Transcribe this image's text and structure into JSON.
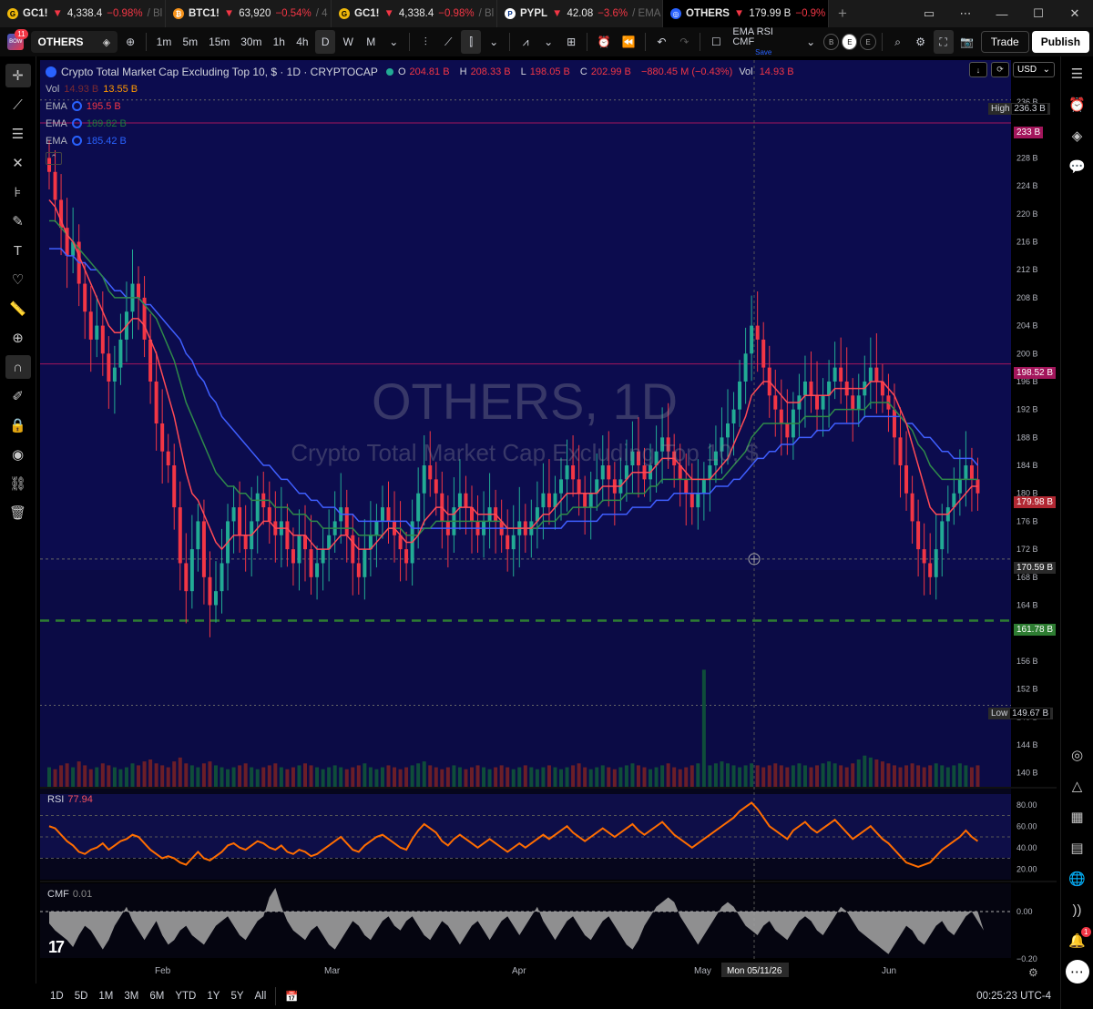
{
  "tabs": [
    {
      "symbol": "GC1!",
      "arrow": "▼",
      "price": "4,338.4",
      "change": "−0.98%",
      "more": "/ Bl",
      "icon_color": "#f0b90b",
      "icon_glyph": "G"
    },
    {
      "symbol": "BTC1!",
      "arrow": "▼",
      "price": "63,920",
      "change": "−0.54%",
      "more": "/ 4",
      "icon_color": "#f7931a",
      "icon_glyph": "₿"
    },
    {
      "symbol": "GC1!",
      "arrow": "▼",
      "price": "4,338.4",
      "change": "−0.98%",
      "more": "/ Bl",
      "icon_color": "#f0b90b",
      "icon_glyph": "G"
    },
    {
      "symbol": "PYPL",
      "arrow": "▼",
      "price": "42.08",
      "change": "−3.6%",
      "more": "/ EMA",
      "icon_color": "#ffffff",
      "icon_glyph": "P"
    },
    {
      "symbol": "OTHERS",
      "arrow": "▼",
      "price": "179.99 B",
      "change": "−0.9%",
      "more": "/",
      "icon_color": "#2962ff",
      "icon_glyph": "◎"
    }
  ],
  "toolbar": {
    "avatar_badge": "11",
    "avatar_text": "BOW",
    "symbol": "OTHERS",
    "intervals": [
      "1m",
      "5m",
      "15m",
      "30m",
      "1h",
      "4h",
      "D",
      "W",
      "M"
    ],
    "active_interval": "D",
    "layout_name": "EMA RSI CMF",
    "layout_status": "Save",
    "toggles": [
      "B",
      "E",
      "E"
    ],
    "trade_label": "Trade",
    "publish_label": "Publish"
  },
  "legend": {
    "title": "Crypto Total Market Cap Excluding Top 10, $ · 1D · CRYPTOCAP",
    "open_label": "O",
    "open": "204.81 B",
    "high_label": "H",
    "high": "208.33 B",
    "low_label": "L",
    "low": "198.05 B",
    "close_label": "C",
    "close": "202.99 B",
    "change": "−880.45 M (−0.43%)",
    "vol_label": "Vol",
    "vol": "14.93 B",
    "vol_ind": {
      "name": "Vol",
      "v1": "14.93 B",
      "v2": "13.55 B"
    },
    "emas": [
      {
        "name": "EMA",
        "value": "195.5 B",
        "color": "#f23645"
      },
      {
        "name": "EMA",
        "value": "189.82 B",
        "color": "#1e7a3c"
      },
      {
        "name": "EMA",
        "value": "185.42 B",
        "color": "#2962ff"
      }
    ]
  },
  "watermark": {
    "line1": "OTHERS, 1D",
    "line2": "Crypto Total Market Cap Excluding Top 10, $"
  },
  "axis": {
    "currency": "USD"
  },
  "price_labels": {
    "high_tag": "High",
    "high_val": "236.3 B",
    "level_233": "233 B",
    "level_198": "198.52 B",
    "last": "179.98 B",
    "crosshair": "170.59 B",
    "support": "161.78 B",
    "low_tag": "Low",
    "low_val": "149.67 B"
  },
  "rsi": {
    "name": "RSI",
    "value": "77.94"
  },
  "cmf": {
    "name": "CMF",
    "value": "0.01"
  },
  "time_labels": {
    "months": [
      "Feb",
      "Mar",
      "Apr",
      "May",
      "Jun"
    ],
    "crosshair_date": "Mon 05/11/26"
  },
  "bottom": {
    "ranges": [
      "1D",
      "5D",
      "1M",
      "3M",
      "6M",
      "YTD",
      "1Y",
      "5Y",
      "All"
    ],
    "clock": "00:25:23 UTC-4"
  },
  "colors": {
    "up": "#22ab94",
    "down": "#f23645",
    "rsi": "#ff6d00",
    "panel_bg": "#0a0a3a"
  },
  "chart_data": {
    "type": "candlestick",
    "title": "OTHERS, 1D",
    "price_ticks": [
      240,
      236,
      232,
      228,
      224,
      220,
      216,
      212,
      208,
      204,
      200,
      196,
      192,
      188,
      184,
      180,
      176,
      172,
      168,
      164,
      160,
      156,
      152,
      148,
      144,
      140
    ],
    "tick_suffix": " B",
    "ylim": [
      138,
      242
    ],
    "rsi_ticks": [
      80,
      60,
      40,
      20
    ],
    "rsi_ticks_text": [
      "80.00",
      "60.00",
      "40.00",
      "20.00"
    ],
    "cmf_ticks_text": [
      "0.00",
      "−0.20"
    ],
    "closes": [
      226,
      222,
      218,
      214,
      216,
      210,
      206,
      202,
      204,
      200,
      196,
      198,
      202,
      206,
      210,
      208,
      202,
      196,
      190,
      186,
      184,
      178,
      170,
      166,
      172,
      176,
      168,
      164,
      166,
      170,
      176,
      178,
      174,
      172,
      176,
      180,
      178,
      176,
      174,
      176,
      172,
      170,
      174,
      172,
      168,
      170,
      172,
      174,
      176,
      178,
      174,
      170,
      168,
      172,
      174,
      176,
      178,
      176,
      174,
      172,
      170,
      176,
      180,
      184,
      182,
      180,
      176,
      174,
      178,
      180,
      178,
      176,
      174,
      176,
      178,
      176,
      174,
      172,
      174,
      176,
      174,
      176,
      178,
      180,
      178,
      180,
      182,
      184,
      182,
      180,
      178,
      180,
      182,
      184,
      182,
      180,
      182,
      184,
      186,
      184,
      182,
      184,
      186,
      188,
      186,
      184,
      182,
      180,
      178,
      180,
      182,
      184,
      186,
      188,
      190,
      192,
      196,
      200,
      204,
      202,
      198,
      194,
      192,
      190,
      188,
      192,
      194,
      196,
      194,
      192,
      194,
      196,
      198,
      196,
      194,
      192,
      194,
      196,
      198,
      196,
      194,
      192,
      188,
      184,
      180,
      176,
      172,
      170,
      168,
      172,
      176,
      178,
      180,
      182,
      184,
      182,
      180
    ],
    "ema_fast": [
      222,
      221,
      219,
      217,
      216,
      214,
      212,
      210,
      208,
      206,
      204,
      203,
      203,
      204,
      205,
      205,
      204,
      202,
      200,
      197,
      194,
      191,
      187,
      183,
      180,
      179,
      177,
      175,
      173,
      172,
      173,
      174,
      174,
      174,
      174,
      175,
      176,
      176,
      175,
      175,
      175,
      174,
      174,
      174,
      173,
      172,
      172,
      172,
      173,
      174,
      174,
      173,
      172,
      172,
      172,
      173,
      174,
      175,
      175,
      174,
      173,
      173,
      174,
      176,
      177,
      178,
      178,
      177,
      177,
      178,
      178,
      178,
      177,
      177,
      177,
      177,
      176,
      175,
      175,
      175,
      175,
      175,
      176,
      177,
      177,
      178,
      179,
      180,
      180,
      180,
      180,
      180,
      180,
      181,
      181,
      181,
      181,
      182,
      183,
      183,
      183,
      183,
      184,
      185,
      185,
      185,
      184,
      183,
      182,
      182,
      182,
      182,
      183,
      184,
      185,
      187,
      189,
      191,
      194,
      195,
      196,
      196,
      195,
      194,
      193,
      193,
      193,
      194,
      194,
      194,
      194,
      194,
      195,
      195,
      195,
      195,
      195,
      195,
      196,
      196,
      196,
      195,
      194,
      192,
      190,
      187,
      184,
      181,
      178,
      177,
      177,
      177,
      178,
      179,
      180,
      181,
      181
    ],
    "ema_mid": [
      219,
      219,
      218,
      217,
      216,
      215,
      214,
      213,
      212,
      211,
      209,
      208,
      208,
      208,
      208,
      208,
      207,
      206,
      205,
      203,
      201,
      199,
      196,
      193,
      191,
      189,
      187,
      185,
      183,
      182,
      181,
      181,
      180,
      180,
      179,
      179,
      179,
      179,
      178,
      178,
      178,
      177,
      177,
      177,
      176,
      176,
      175,
      175,
      175,
      175,
      175,
      175,
      174,
      174,
      174,
      174,
      174,
      175,
      175,
      175,
      174,
      174,
      174,
      175,
      175,
      176,
      176,
      176,
      176,
      176,
      176,
      176,
      176,
      176,
      176,
      176,
      176,
      175,
      175,
      175,
      175,
      175,
      175,
      176,
      176,
      176,
      177,
      177,
      178,
      178,
      178,
      178,
      178,
      179,
      179,
      179,
      179,
      180,
      180,
      180,
      180,
      181,
      181,
      182,
      182,
      182,
      182,
      182,
      182,
      182,
      182,
      182,
      182,
      182,
      183,
      184,
      185,
      186,
      188,
      189,
      190,
      190,
      190,
      190,
      190,
      190,
      190,
      191,
      191,
      191,
      191,
      191,
      192,
      192,
      192,
      192,
      192,
      192,
      193,
      193,
      193,
      193,
      192,
      191,
      190,
      189,
      187,
      186,
      184,
      183,
      182,
      182,
      182,
      182,
      182,
      182,
      182
    ],
    "ema_slow": [
      215,
      215,
      215,
      214,
      214,
      213,
      213,
      212,
      212,
      211,
      210,
      209,
      209,
      208,
      208,
      208,
      207,
      207,
      206,
      205,
      204,
      203,
      202,
      200,
      199,
      197,
      196,
      194,
      193,
      191,
      190,
      189,
      188,
      187,
      186,
      185,
      184,
      184,
      183,
      182,
      182,
      181,
      180,
      180,
      179,
      179,
      178,
      178,
      178,
      177,
      177,
      177,
      176,
      176,
      176,
      176,
      176,
      176,
      176,
      176,
      176,
      175,
      175,
      175,
      175,
      175,
      175,
      175,
      175,
      175,
      175,
      175,
      175,
      175,
      175,
      175,
      175,
      175,
      175,
      175,
      175,
      175,
      175,
      175,
      175,
      175,
      175,
      176,
      176,
      176,
      176,
      176,
      176,
      177,
      177,
      177,
      177,
      177,
      178,
      178,
      178,
      178,
      179,
      179,
      179,
      180,
      180,
      180,
      180,
      180,
      180,
      180,
      181,
      181,
      181,
      182,
      182,
      183,
      184,
      185,
      185,
      186,
      186,
      187,
      187,
      187,
      188,
      188,
      188,
      189,
      189,
      189,
      190,
      190,
      190,
      190,
      190,
      191,
      191,
      191,
      191,
      191,
      191,
      191,
      190,
      190,
      189,
      188,
      188,
      187,
      186,
      186,
      185,
      185,
      185,
      185,
      184
    ],
    "rsi_values": [
      60,
      58,
      52,
      46,
      42,
      36,
      34,
      38,
      40,
      44,
      38,
      42,
      46,
      48,
      52,
      50,
      44,
      38,
      34,
      30,
      32,
      30,
      26,
      24,
      30,
      36,
      30,
      28,
      32,
      36,
      42,
      44,
      40,
      38,
      42,
      46,
      44,
      40,
      38,
      42,
      36,
      34,
      38,
      36,
      32,
      34,
      38,
      42,
      46,
      50,
      44,
      38,
      36,
      42,
      46,
      50,
      52,
      48,
      44,
      40,
      38,
      48,
      56,
      62,
      58,
      54,
      46,
      42,
      48,
      52,
      48,
      44,
      40,
      44,
      48,
      44,
      40,
      36,
      40,
      44,
      40,
      44,
      48,
      52,
      48,
      52,
      56,
      60,
      54,
      50,
      46,
      50,
      54,
      58,
      54,
      50,
      54,
      58,
      62,
      56,
      52,
      56,
      60,
      64,
      58,
      52,
      48,
      44,
      40,
      44,
      48,
      52,
      56,
      60,
      64,
      68,
      74,
      78,
      82,
      76,
      68,
      60,
      56,
      52,
      48,
      56,
      60,
      64,
      58,
      54,
      58,
      62,
      66,
      60,
      54,
      48,
      52,
      56,
      60,
      54,
      48,
      44,
      38,
      32,
      26,
      24,
      22,
      24,
      26,
      32,
      38,
      42,
      46,
      50,
      56,
      50,
      46
    ],
    "cmf_values": [
      -0.05,
      -0.08,
      -0.1,
      -0.12,
      -0.15,
      -0.1,
      -0.06,
      -0.08,
      -0.12,
      -0.16,
      -0.12,
      -0.06,
      -0.02,
      0.02,
      -0.04,
      -0.08,
      -0.12,
      -0.08,
      -0.04,
      -0.1,
      -0.14,
      -0.12,
      -0.08,
      -0.06,
      -0.1,
      -0.12,
      -0.14,
      -0.1,
      -0.06,
      -0.04,
      -0.02,
      -0.06,
      -0.1,
      -0.12,
      -0.08,
      -0.04,
      -0.02,
      0.06,
      0.1,
      0.02,
      -0.04,
      -0.08,
      -0.1,
      -0.12,
      -0.08,
      -0.06,
      -0.1,
      -0.14,
      -0.16,
      -0.12,
      -0.08,
      -0.04,
      -0.06,
      -0.1,
      -0.12,
      -0.08,
      -0.04,
      -0.02,
      -0.06,
      -0.08,
      -0.04,
      -0.02,
      -0.06,
      -0.1,
      -0.12,
      -0.08,
      -0.04,
      -0.06,
      -0.1,
      -0.14,
      -0.1,
      -0.06,
      -0.04,
      -0.08,
      -0.12,
      -0.08,
      -0.04,
      -0.02,
      -0.06,
      -0.1,
      -0.06,
      -0.02,
      0.02,
      -0.04,
      -0.08,
      -0.12,
      -0.08,
      -0.04,
      -0.02,
      -0.06,
      -0.1,
      -0.12,
      -0.08,
      -0.04,
      -0.02,
      -0.06,
      -0.1,
      -0.14,
      -0.16,
      -0.12,
      -0.06,
      -0.02,
      0.02,
      0.04,
      0.06,
      0.04,
      -0.02,
      -0.06,
      -0.1,
      -0.14,
      -0.1,
      -0.06,
      -0.02,
      0.02,
      0.04,
      0.02,
      -0.02,
      -0.06,
      -0.08,
      -0.1,
      -0.06,
      -0.04,
      -0.08,
      -0.1,
      -0.12,
      -0.08,
      -0.04,
      -0.02,
      -0.04,
      -0.08,
      -0.1,
      -0.06,
      -0.02,
      0.02,
      0.0,
      -0.04,
      -0.08,
      -0.1,
      -0.12,
      -0.14,
      -0.16,
      -0.18,
      -0.14,
      -0.1,
      -0.06,
      -0.08,
      -0.12,
      -0.14,
      -0.1,
      -0.06,
      -0.04,
      -0.08,
      -0.1,
      -0.06,
      -0.02,
      0.0,
      -0.04,
      -0.08
    ],
    "volumes": [
      10,
      9,
      11,
      12,
      10,
      13,
      11,
      9,
      10,
      12,
      11,
      10,
      9,
      10,
      12,
      11,
      13,
      14,
      12,
      11,
      10,
      13,
      15,
      12,
      11,
      10,
      12,
      13,
      11,
      10,
      9,
      10,
      11,
      12,
      10,
      9,
      10,
      11,
      12,
      10,
      9,
      10,
      11,
      12,
      11,
      10,
      9,
      10,
      11,
      10,
      9,
      10,
      11,
      12,
      10,
      9,
      10,
      11,
      10,
      9,
      10,
      11,
      12,
      13,
      11,
      10,
      9,
      10,
      11,
      10,
      9,
      10,
      11,
      10,
      9,
      10,
      11,
      10,
      9,
      10,
      11,
      10,
      9,
      10,
      11,
      10,
      9,
      10,
      11,
      12,
      10,
      9,
      10,
      11,
      10,
      9,
      10,
      11,
      12,
      11,
      10,
      9,
      10,
      11,
      12,
      10,
      9,
      10,
      11,
      12,
      60,
      11,
      12,
      13,
      12,
      11,
      10,
      11,
      12,
      11,
      10,
      11,
      12,
      11,
      10,
      11,
      12,
      11,
      10,
      11,
      12,
      13,
      12,
      11,
      10,
      12,
      14,
      16,
      15,
      14,
      13,
      12,
      11,
      10,
      11,
      12,
      11,
      10,
      11,
      12,
      11,
      10,
      11,
      12,
      11,
      10,
      11
    ]
  }
}
